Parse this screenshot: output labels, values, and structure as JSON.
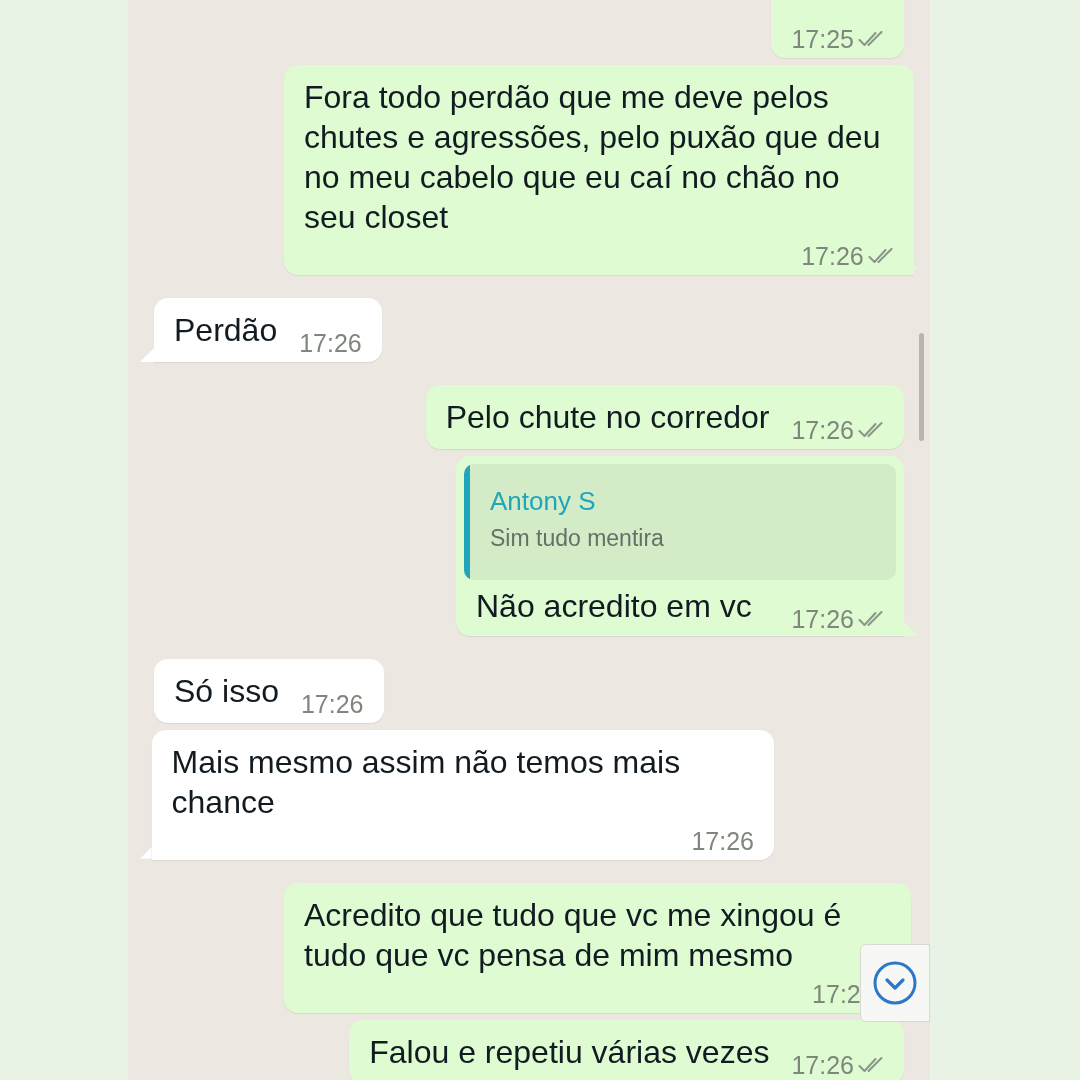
{
  "messages": [
    {
      "kind": "out",
      "time": "17:25",
      "delivered": true,
      "tail": false
    },
    {
      "kind": "out",
      "text": "Fora todo perdão que me deve pelos chutes e agressões, pelo puxão que deu no meu cabelo que eu caí no chão no seu closet",
      "time": "17:26",
      "delivered": true,
      "tail": true
    },
    {
      "kind": "in",
      "text": "Perdão",
      "time": "17:26",
      "tail": true
    },
    {
      "kind": "out",
      "text": "Pelo chute no corredor",
      "time": "17:26",
      "delivered": true,
      "tail": false
    },
    {
      "kind": "out",
      "reply": {
        "author": "Antony S",
        "text": "Sim tudo mentira"
      },
      "text": "Não acredito em vc",
      "time": "17:26",
      "delivered": true,
      "tail": true
    },
    {
      "kind": "in",
      "text": "Só isso",
      "time": "17:26",
      "tail": false
    },
    {
      "kind": "in",
      "text": "Mais mesmo assim não temos mais chance",
      "time": "17:26",
      "tail": true
    },
    {
      "kind": "out",
      "text": "Acredito que tudo que vc me xingou é tudo que vc pensa de mim mesmo",
      "time": "17:2",
      "tail": false
    },
    {
      "kind": "out",
      "text": "Falou e repetiu várias vezes",
      "time": "17:26",
      "delivered": true,
      "tail": false
    }
  ]
}
